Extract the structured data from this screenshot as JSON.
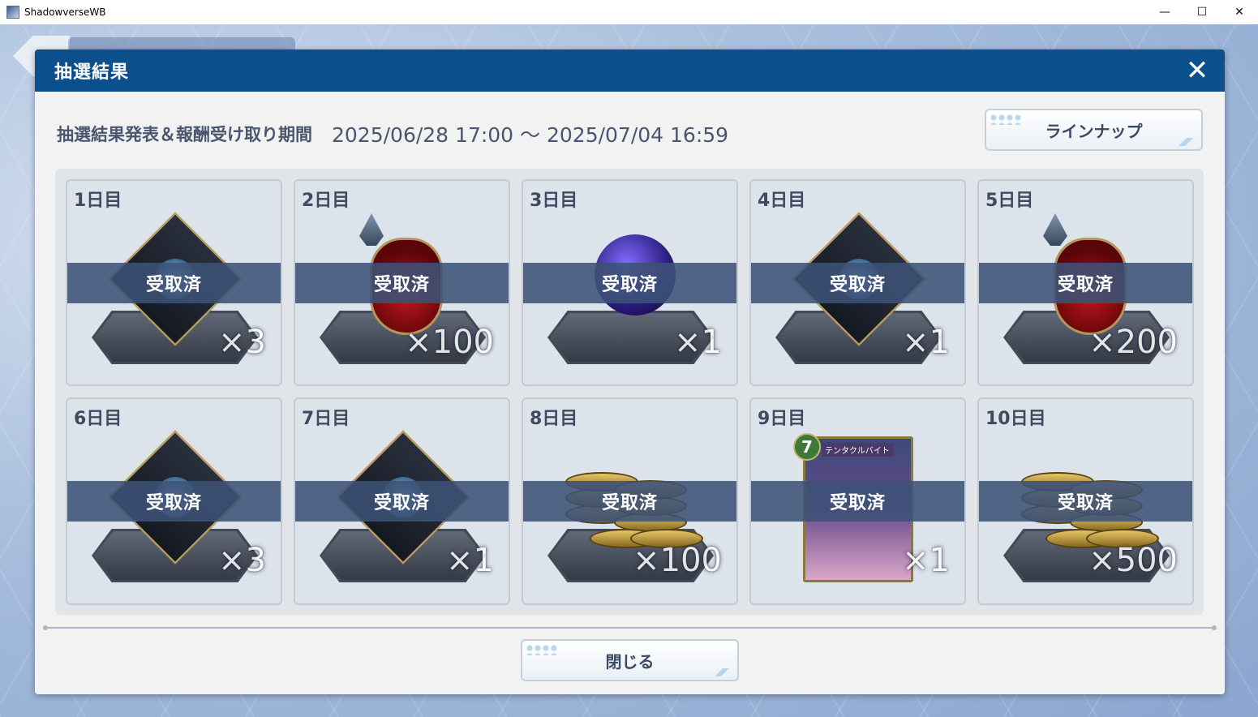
{
  "window": {
    "title": "ShadowverseWB",
    "controls": {
      "minimize": "—",
      "maximize": "☐",
      "close": "✕"
    }
  },
  "modal": {
    "title": "抽選結果",
    "close_icon": "✕",
    "period_label": "抽選結果発表＆報酬受け取り期間",
    "period_range": "2025/06/28 17:00 ～ 2025/07/04 16:59",
    "lineup_button": "ラインナップ",
    "close_button": "閉じる"
  },
  "rewards": [
    {
      "day": "1日目",
      "status": "受取済",
      "quantity": "×3",
      "item": "shard"
    },
    {
      "day": "2日目",
      "status": "受取済",
      "quantity": "×100",
      "item": "potion"
    },
    {
      "day": "3日目",
      "status": "受取済",
      "quantity": "×1",
      "item": "orb"
    },
    {
      "day": "4日目",
      "status": "受取済",
      "quantity": "×1",
      "item": "shard"
    },
    {
      "day": "5日目",
      "status": "受取済",
      "quantity": "×200",
      "item": "potion"
    },
    {
      "day": "6日目",
      "status": "受取済",
      "quantity": "×3",
      "item": "shard"
    },
    {
      "day": "7日目",
      "status": "受取済",
      "quantity": "×1",
      "item": "shard"
    },
    {
      "day": "8日目",
      "status": "受取済",
      "quantity": "×100",
      "item": "coins"
    },
    {
      "day": "9日目",
      "status": "受取済",
      "quantity": "×1",
      "item": "card",
      "card_name": "テンタクルバイト",
      "card_cost": "7"
    },
    {
      "day": "10日目",
      "status": "受取済",
      "quantity": "×500",
      "item": "coins"
    }
  ],
  "colors": {
    "header": "#0b4f8c",
    "band": "#3c5276",
    "text": "#4a5670"
  }
}
